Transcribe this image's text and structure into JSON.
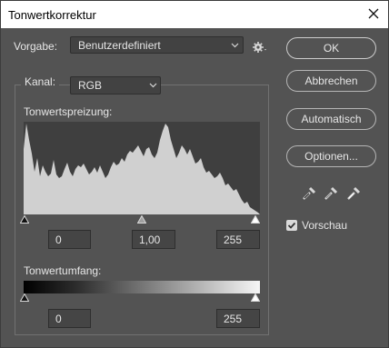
{
  "window": {
    "title": "Tonwertkorrektur"
  },
  "preset": {
    "label": "Vorgabe:",
    "value": "Benutzerdefiniert"
  },
  "channel": {
    "label": "Kanal:",
    "value": "RGB"
  },
  "input_levels": {
    "label": "Tonwertspreizung:",
    "black": "0",
    "gamma": "1,00",
    "white": "255"
  },
  "output_levels": {
    "label": "Tonwertumfang:",
    "black": "0",
    "white": "255"
  },
  "buttons": {
    "ok": "OK",
    "cancel": "Abbrechen",
    "auto": "Automatisch",
    "options": "Optionen..."
  },
  "preview": {
    "label": "Vorschau",
    "checked": true
  },
  "icons": {
    "close": "close-icon",
    "settings": "gear-icon",
    "eyedroppers": [
      "black-point-eyedropper-icon",
      "gray-point-eyedropper-icon",
      "white-point-eyedropper-icon"
    ]
  },
  "colors": {
    "dialog_bg": "#535353",
    "histogram_fill": "#d0d0d0",
    "histogram_bg": "#3f3f3f"
  }
}
